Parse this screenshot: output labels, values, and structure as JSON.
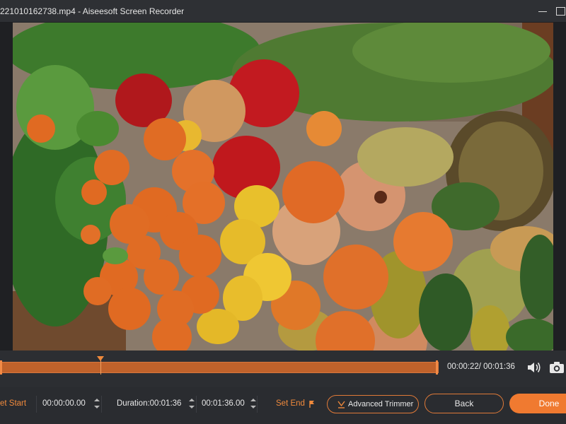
{
  "window": {
    "title": "221010162738.mp4  -  Aiseesoft Screen Recorder"
  },
  "player": {
    "time_readout": "00:00:22/ 00:01:36",
    "progress_fraction": 0.229
  },
  "controls": {
    "set_start_label": "et Start",
    "start_time": "00:00:00.00",
    "duration": "Duration:00:01:36",
    "end_time": "00:01:36.00",
    "set_end_label": "Set End",
    "advanced_trimmer_label": "Advanced Trimmer",
    "back_label": "Back",
    "done_label": "Done"
  },
  "colors": {
    "accent": "#f07a30",
    "background": "#2a2c30",
    "track": "#c0622b"
  },
  "icons": {
    "minimize": "minimize-icon",
    "maximize": "maximize-icon",
    "volume": "volume-icon",
    "camera": "camera-icon",
    "set_end": "set-end-icon",
    "trimmer": "trimmer-icon"
  }
}
